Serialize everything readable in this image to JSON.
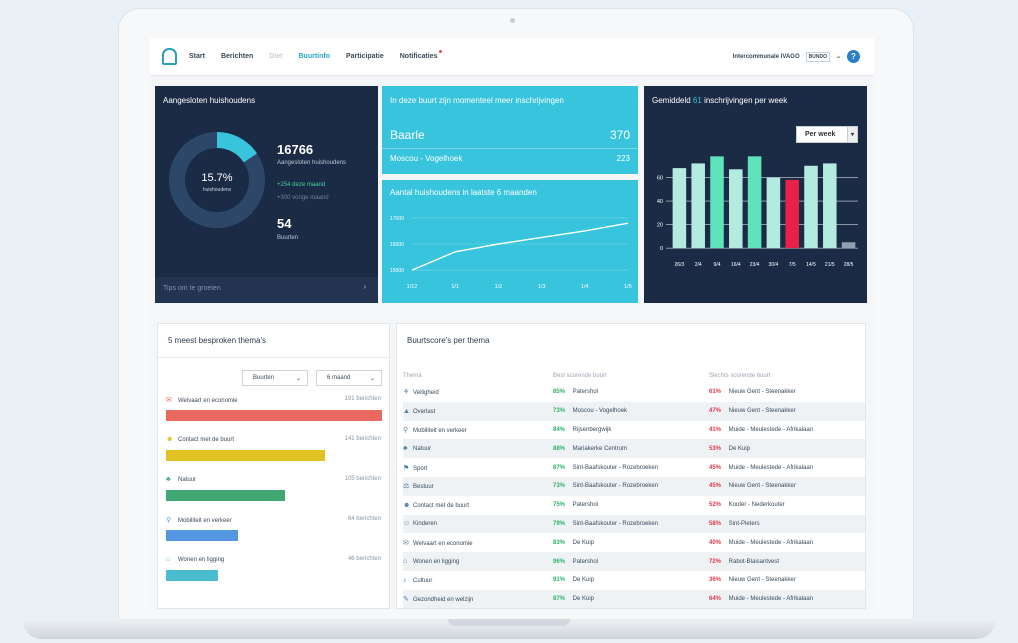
{
  "nav": {
    "links": [
      "Start",
      "Berichten",
      "Diet",
      "Buurtinfo",
      "Participatie",
      "Notificaties"
    ],
    "org": "Intercommunale IVAGO",
    "brand": "BUNDO",
    "help": "?"
  },
  "households": {
    "title": "Aangesloten huishoudens",
    "pct": "15.7%",
    "pct_label": "huishoudens",
    "pct_value": 0.157,
    "total": "16766",
    "total_label": "Aangesloten huishoudens",
    "month": "+254 deze maand",
    "prev": "+300 vorige maand",
    "neigh": "54",
    "neigh_label": "Buurten",
    "footer": "Tips om te groeien"
  },
  "signups": {
    "title": "In deze buurt zijn momenteel meer inschrijvingen",
    "rows": [
      {
        "name": "Baarle",
        "value": "370"
      },
      {
        "name": "Moscou - Vogelhoek",
        "value": "223"
      }
    ]
  },
  "trend": {
    "title": "Aantal huishoudens in laatste 6 maanden",
    "chart_data": {
      "type": "line",
      "x": [
        "1/12",
        "1/1",
        "1/2",
        "1/3",
        "1/4",
        "1/5"
      ],
      "values": [
        15000,
        15700,
        16000,
        16250,
        16500,
        16800
      ],
      "y_ticks": [
        "17000",
        "16000",
        "15000"
      ],
      "ylim": [
        14850,
        17150
      ]
    }
  },
  "weekly": {
    "title_pre": "Gemiddeld",
    "title_num": "61",
    "title_post": "inschrijvingen per week",
    "select": "Per week",
    "chart_data": {
      "type": "bar",
      "categories": [
        "26/3",
        "2/4",
        "9/4",
        "16/4",
        "23/4",
        "30/4",
        "7/5",
        "14/5",
        "21/5",
        "28/5"
      ],
      "values": [
        68,
        72,
        78,
        67,
        78,
        60,
        58,
        70,
        72,
        5
      ],
      "colors": [
        "#b3ebe0",
        "#b3ebe0",
        "#5fe3bb",
        "#b3ebe0",
        "#5fe3bb",
        "#b3ebe0",
        "#e8204a",
        "#b3ebe0",
        "#b3ebe0",
        "#8fa0b3"
      ],
      "y_ticks": [
        0,
        20,
        40,
        60
      ],
      "ylim": [
        -5,
        80
      ]
    }
  },
  "themes": {
    "title": "5 meest besproken thema's",
    "filter1": "Buurten",
    "filter2": "6 maand",
    "items": [
      {
        "label": "Welvaart en economie",
        "count": "191 berichten",
        "color": "#ea6a62",
        "value": 191,
        "icon": "✉"
      },
      {
        "label": "Contact met de buurt",
        "count": "141 berichten",
        "color": "#e1c222",
        "value": 141,
        "icon": "☻"
      },
      {
        "label": "Natuur",
        "count": "105 berichten",
        "color": "#41a873",
        "value": 105,
        "icon": "♣"
      },
      {
        "label": "Mobiliteit en verkeer",
        "count": "64 berichten",
        "color": "#5596e0",
        "value": 64,
        "icon": "⚲"
      },
      {
        "label": "Wonen en ligging",
        "count": "46 berichten",
        "color": "#4bbccd",
        "value": 46,
        "icon": "⌂"
      }
    ]
  },
  "scores": {
    "title": "Buurtscore's per thema",
    "headers": [
      "Thema",
      "Best scorende buurt",
      "Slechts scorende buurt"
    ],
    "rows": [
      [
        "Veiligheid",
        "85%",
        "Patershol",
        "61%",
        "Nieuw Gent - Steenakker"
      ],
      [
        "Overlast",
        "73%",
        "Moscou - Vogelhoek",
        "47%",
        "Nieuw Gent - Steenakker"
      ],
      [
        "Mobiliteit en verkeer",
        "84%",
        "Rijsenbergwijk",
        "41%",
        "Muide - Meulestede - Afrikalaan"
      ],
      [
        "Natuur",
        "88%",
        "Mariakerke Centrum",
        "53%",
        "De Kuip"
      ],
      [
        "Sport",
        "87%",
        "Sint-Baafskouter - Rozebroeken",
        "45%",
        "Muide - Meulestede - Afrikalaan"
      ],
      [
        "Bestuur",
        "73%",
        "Sint-Baafskouter - Rozebroeken",
        "45%",
        "Nieuw Gent - Steenakker"
      ],
      [
        "Contact met de buurt",
        "75%",
        "Patershol",
        "52%",
        "Kouter - Nederkouter"
      ],
      [
        "Kinderen",
        "79%",
        "Sint-Baafskouter - Rozebroeken",
        "58%",
        "Sint-Pieters"
      ],
      [
        "Welvaart en economie",
        "83%",
        "De Kuip",
        "40%",
        "Muide - Meulestede - Afrikalaan"
      ],
      [
        "Wonen en ligging",
        "96%",
        "Patershol",
        "72%",
        "Rabot-Blaisantvest"
      ],
      [
        "Cultuur",
        "91%",
        "De Kuip",
        "36%",
        "Nieuw Gent - Steenakker"
      ],
      [
        "Gezondheid en welzijn",
        "87%",
        "De Kuip",
        "64%",
        "Muide - Meulestede - Afrikalaan"
      ]
    ]
  }
}
